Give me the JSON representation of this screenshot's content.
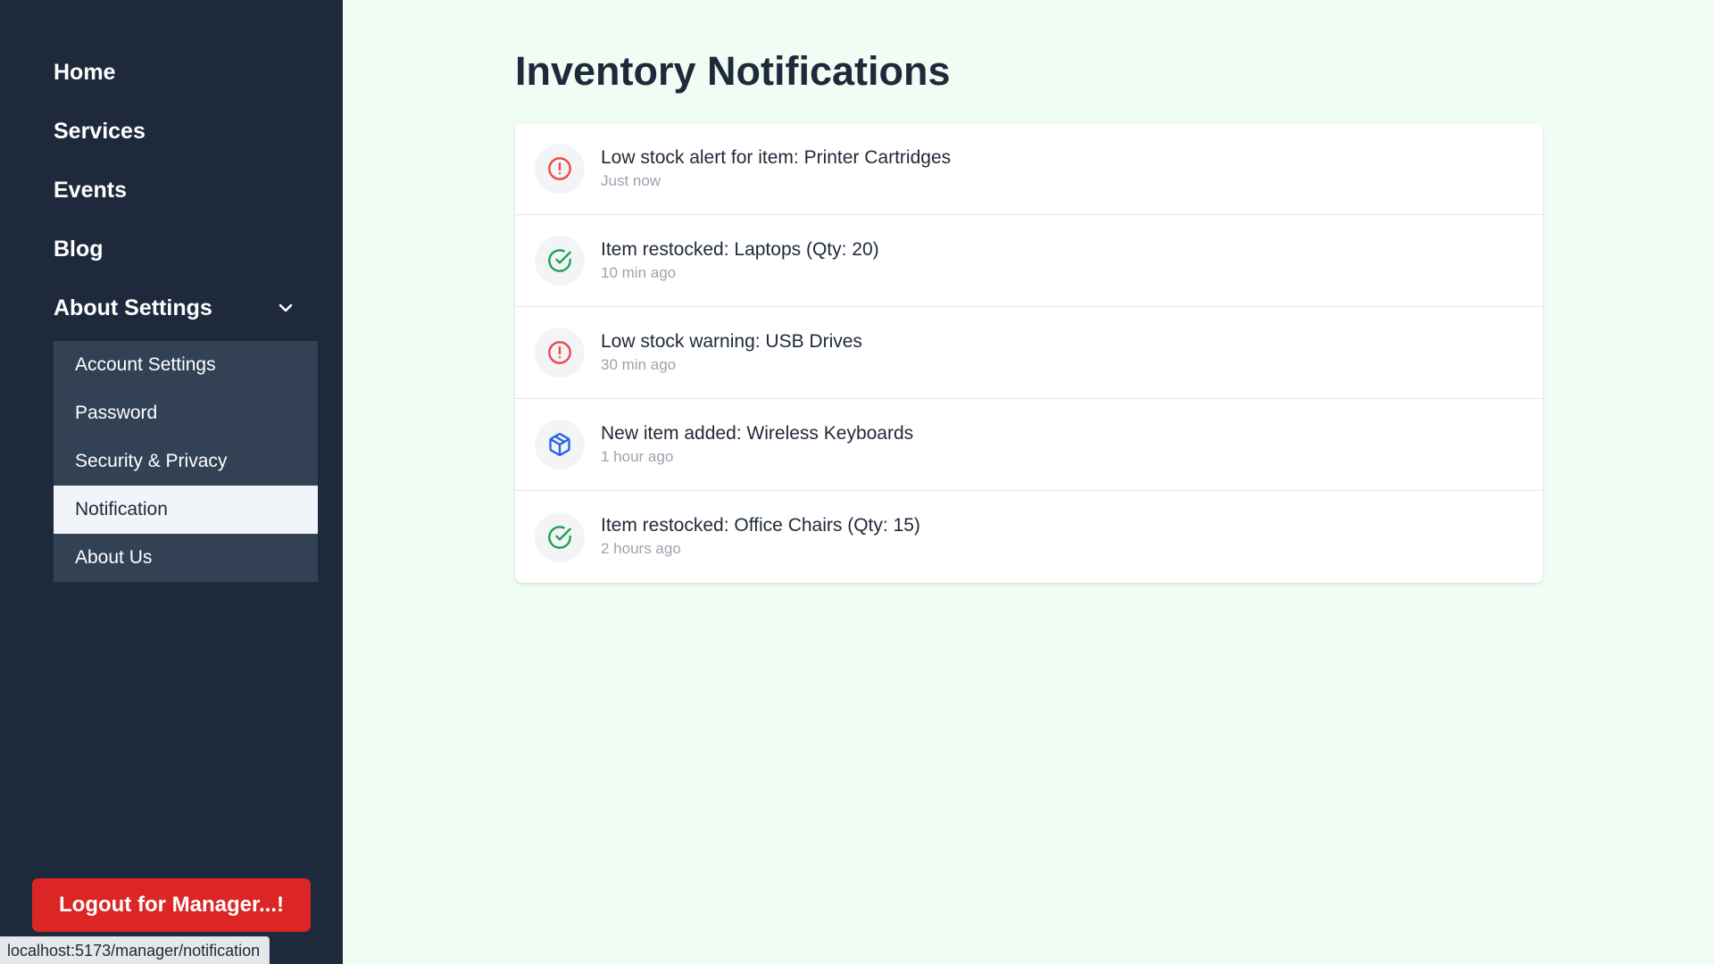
{
  "sidebar": {
    "nav": [
      {
        "label": "Home"
      },
      {
        "label": "Services"
      },
      {
        "label": "Events"
      },
      {
        "label": "Blog"
      },
      {
        "label": "About Settings"
      }
    ],
    "submenu": [
      {
        "label": "Account Settings"
      },
      {
        "label": "Password"
      },
      {
        "label": "Security & Privacy"
      },
      {
        "label": "Notification",
        "active": true
      },
      {
        "label": "About Us"
      }
    ],
    "logout_label": "Logout for Manager...!"
  },
  "status_bar": {
    "url": "localhost:5173/manager/notification"
  },
  "main": {
    "title": "Inventory Notifications",
    "notifications": [
      {
        "icon": "alert-circle-icon",
        "color": "#ef4444",
        "title": "Low stock alert for item: Printer Cartridges",
        "time": "Just now"
      },
      {
        "icon": "check-circle-icon",
        "color": "#16a34a",
        "title": "Item restocked: Laptops (Qty: 20)",
        "time": "10 min ago"
      },
      {
        "icon": "alert-circle-icon",
        "color": "#ef4444",
        "title": "Low stock warning: USB Drives",
        "time": "30 min ago"
      },
      {
        "icon": "package-icon",
        "color": "#2563eb",
        "title": "New item added: Wireless Keyboards",
        "time": "1 hour ago"
      },
      {
        "icon": "check-circle-icon",
        "color": "#16a34a",
        "title": "Item restocked: Office Chairs (Qty: 15)",
        "time": "2 hours ago"
      }
    ]
  },
  "colors": {
    "sidebar_bg": "#1e293b",
    "submenu_bg": "#334155",
    "page_bg": "#f0fdf4",
    "logout_bg": "#dc2626"
  }
}
